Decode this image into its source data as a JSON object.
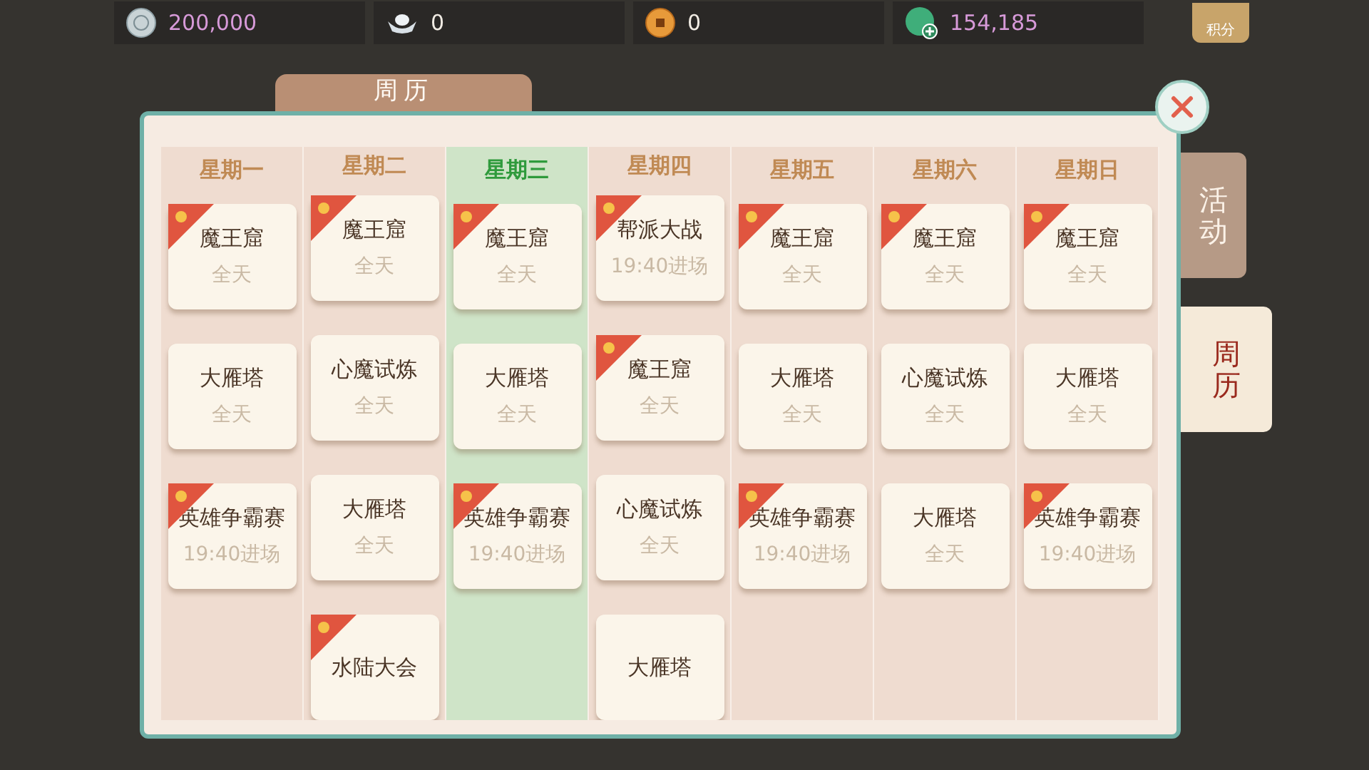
{
  "currency_bar": [
    {
      "kind": "silver",
      "value": "200,000"
    },
    {
      "kind": "ingot",
      "value": "0"
    },
    {
      "kind": "coin",
      "value": "0"
    },
    {
      "kind": "jade",
      "value": "154,185"
    }
  ],
  "points_badge": "积分",
  "panel": {
    "title": "周历"
  },
  "side_tabs": [
    {
      "label": "活动",
      "selected": false
    },
    {
      "label": "周历",
      "selected": true
    }
  ],
  "days": [
    {
      "label": "星期一",
      "selected": false,
      "events": [
        {
          "name": "魔王窟",
          "time": "全天",
          "tagged": true
        },
        {
          "name": "大雁塔",
          "time": "全天",
          "tagged": false
        },
        {
          "name": "英雄争霸赛",
          "time": "19:40进场",
          "tagged": true
        }
      ]
    },
    {
      "label": "星期二",
      "selected": false,
      "events": [
        {
          "name": "魔王窟",
          "time": "全天",
          "tagged": true
        },
        {
          "name": "心魔试炼",
          "time": "全天",
          "tagged": false
        },
        {
          "name": "大雁塔",
          "time": "全天",
          "tagged": false
        },
        {
          "name": "水陆大会",
          "tagged": true
        }
      ]
    },
    {
      "label": "星期三",
      "selected": true,
      "events": [
        {
          "name": "魔王窟",
          "time": "全天",
          "tagged": true
        },
        {
          "name": "大雁塔",
          "time": "全天",
          "tagged": false
        },
        {
          "name": "英雄争霸赛",
          "time": "19:40进场",
          "tagged": true
        }
      ]
    },
    {
      "label": "星期四",
      "selected": false,
      "events": [
        {
          "name": "帮派大战",
          "time": "19:40进场",
          "tagged": true
        },
        {
          "name": "魔王窟",
          "time": "全天",
          "tagged": true
        },
        {
          "name": "心魔试炼",
          "time": "全天",
          "tagged": false
        },
        {
          "name": "大雁塔",
          "tagged": false
        }
      ]
    },
    {
      "label": "星期五",
      "selected": false,
      "events": [
        {
          "name": "魔王窟",
          "time": "全天",
          "tagged": true
        },
        {
          "name": "大雁塔",
          "time": "全天",
          "tagged": false
        },
        {
          "name": "英雄争霸赛",
          "time": "19:40进场",
          "tagged": true
        }
      ]
    },
    {
      "label": "星期六",
      "selected": false,
      "events": [
        {
          "name": "魔王窟",
          "time": "全天",
          "tagged": true
        },
        {
          "name": "心魔试炼",
          "time": "全天",
          "tagged": false
        },
        {
          "name": "大雁塔",
          "time": "全天",
          "tagged": false
        }
      ]
    },
    {
      "label": "星期日",
      "selected": false,
      "events": [
        {
          "name": "魔王窟",
          "time": "全天",
          "tagged": true
        },
        {
          "name": "大雁塔",
          "time": "全天",
          "tagged": false
        },
        {
          "name": "英雄争霸赛",
          "time": "19:40进场",
          "tagged": true
        }
      ]
    }
  ]
}
